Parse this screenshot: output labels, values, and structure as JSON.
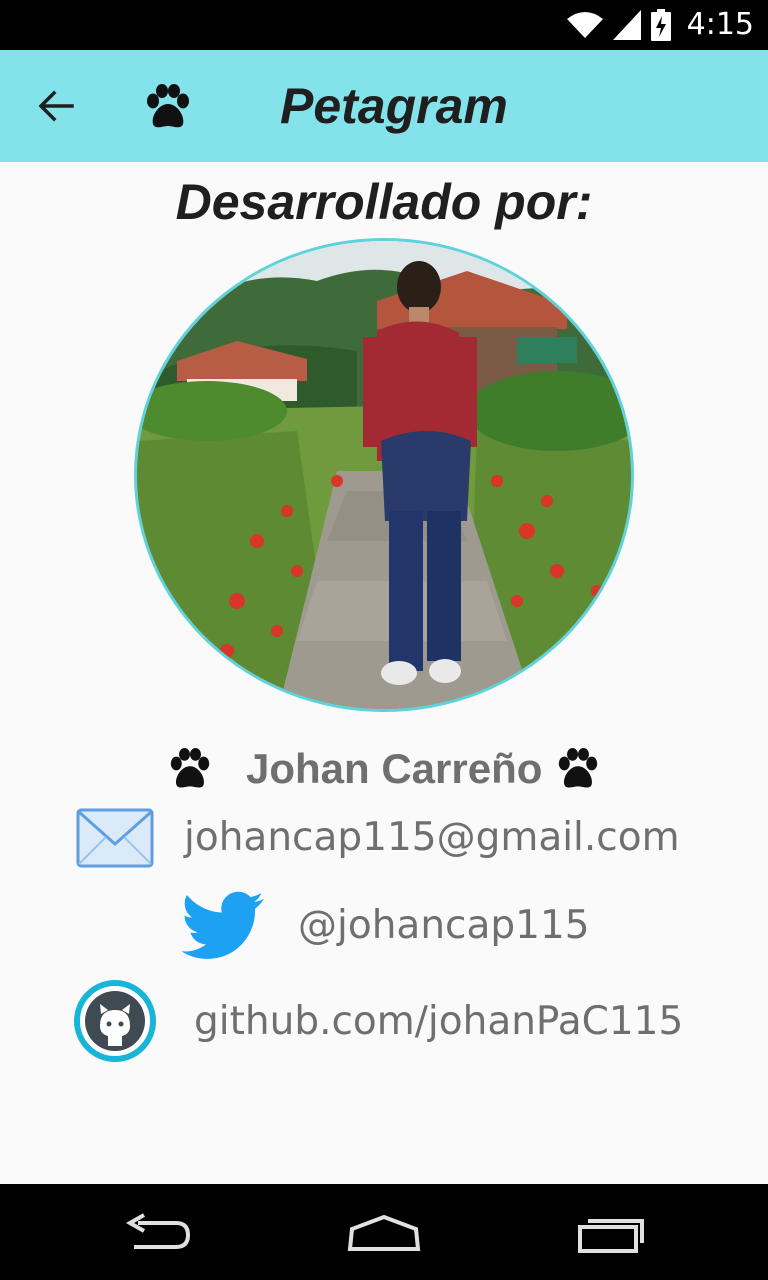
{
  "status_bar": {
    "time": "4:15",
    "icons": [
      "wifi-icon",
      "cell-signal-icon",
      "battery-charging-icon"
    ]
  },
  "app_bar": {
    "title": "Petagram",
    "icons": [
      "back-arrow-icon",
      "paw-icon"
    ]
  },
  "about": {
    "heading": "Desarrollado por:",
    "developer_name": "Johan Carreño",
    "email": "johancap115@gmail.com",
    "twitter": "@johancap115",
    "github": "github.com/johanPaC115"
  },
  "colors": {
    "app_bar": "#84e2ea",
    "photo_border": "#5fd3dc",
    "text_secondary": "#6f6f6f",
    "twitter_blue": "#1da1f2"
  },
  "nav_bar": {
    "icons": [
      "back-nav-icon",
      "home-nav-icon",
      "recents-nav-icon"
    ]
  }
}
